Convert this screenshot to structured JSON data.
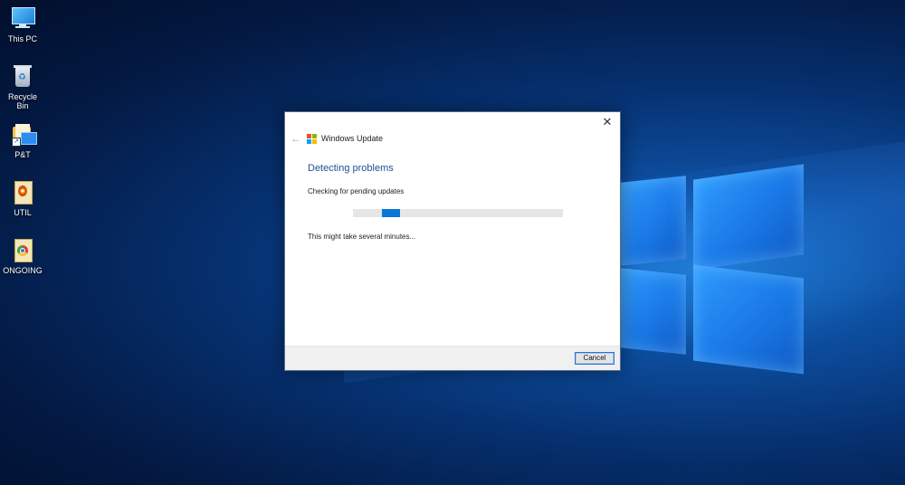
{
  "desktop": {
    "icons": [
      {
        "label": "This PC",
        "icon": "computer-icon"
      },
      {
        "label": "Recycle Bin",
        "icon": "recycle-bin-icon"
      },
      {
        "label": "P&T",
        "icon": "folder-shortcut-icon"
      },
      {
        "label": "UTIL",
        "icon": "document-icon"
      },
      {
        "label": "ONGOING",
        "icon": "chrome-document-icon"
      }
    ]
  },
  "dialog": {
    "title": "Windows Update",
    "close_glyph": "✕",
    "back_glyph": "←",
    "heading": "Detecting problems",
    "status": "Checking for pending updates",
    "note": "This might take several minutes...",
    "progress": {
      "indeterminate": true,
      "fill_position": 0.14
    },
    "cancel_label": "Cancel"
  },
  "colors": {
    "heading": "#1f4e9a",
    "progress_fill": "#0a78d7",
    "progress_track": "#e6e6e6"
  }
}
